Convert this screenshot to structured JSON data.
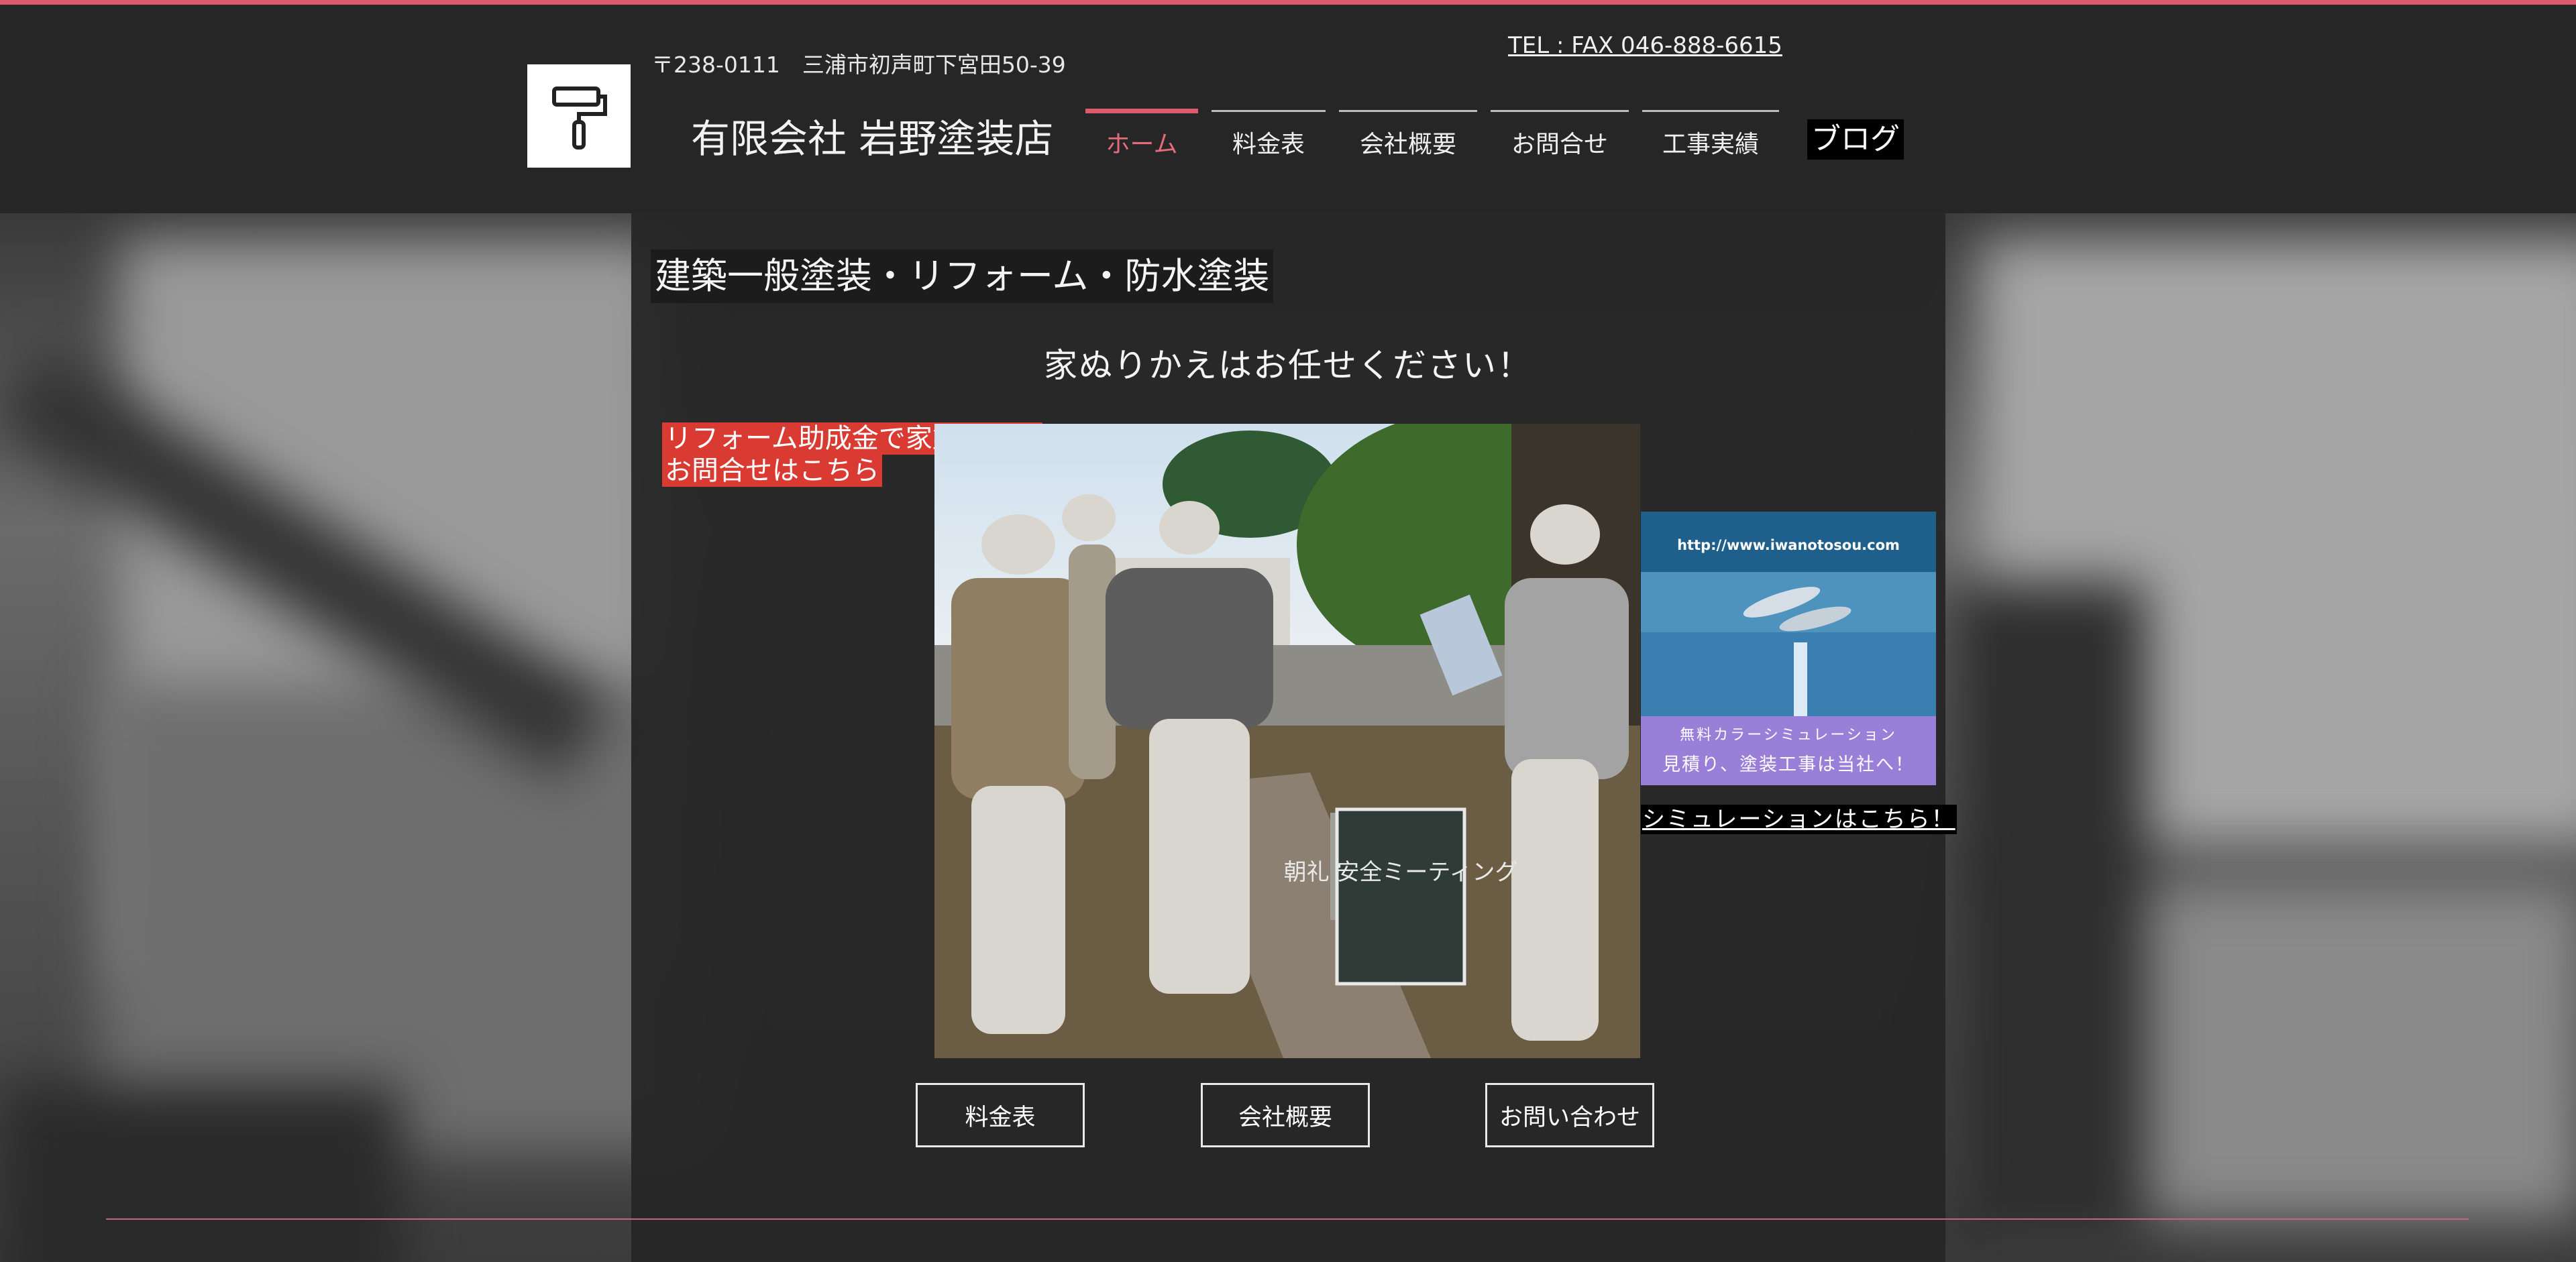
{
  "header": {
    "address": "〒238-0111　三浦市初声町下宮田50-39",
    "company_name": "有限会社 岩野塗装店",
    "tel_fax": "TEL : FAX 046-888-6615",
    "logo_icon": "paint-roller-icon"
  },
  "nav": {
    "items": [
      {
        "label": "ホーム",
        "active": true
      },
      {
        "label": "料金表",
        "active": false
      },
      {
        "label": "会社概要",
        "active": false
      },
      {
        "label": "お問合せ",
        "active": false
      },
      {
        "label": "工事実績",
        "active": false
      }
    ],
    "blog_label": "ブログ"
  },
  "main": {
    "headline": "建築一般塗装・リフォーム・防水塗装",
    "subheadline": "家ぬりかえはお任せください！",
    "subsidy_line1": "リフォーム助成金で家塗装を！",
    "subsidy_line2": "お問合せはこちら",
    "photo_sign": "朝礼 安全ミーティング"
  },
  "ad": {
    "url": "http://www.iwanotosou.com",
    "line1": "無料カラーシミュレーション",
    "line2": "見積り、塗装工事は当社へ！",
    "link_label": "シミュレーションはこちら！"
  },
  "buttons": {
    "price": "料金表",
    "company": "会社概要",
    "contact": "お問い合わせ"
  },
  "colors": {
    "accent": "#e05a6e",
    "subsidy_bg": "#d93b33",
    "ad_band": "#9a7fd8"
  }
}
